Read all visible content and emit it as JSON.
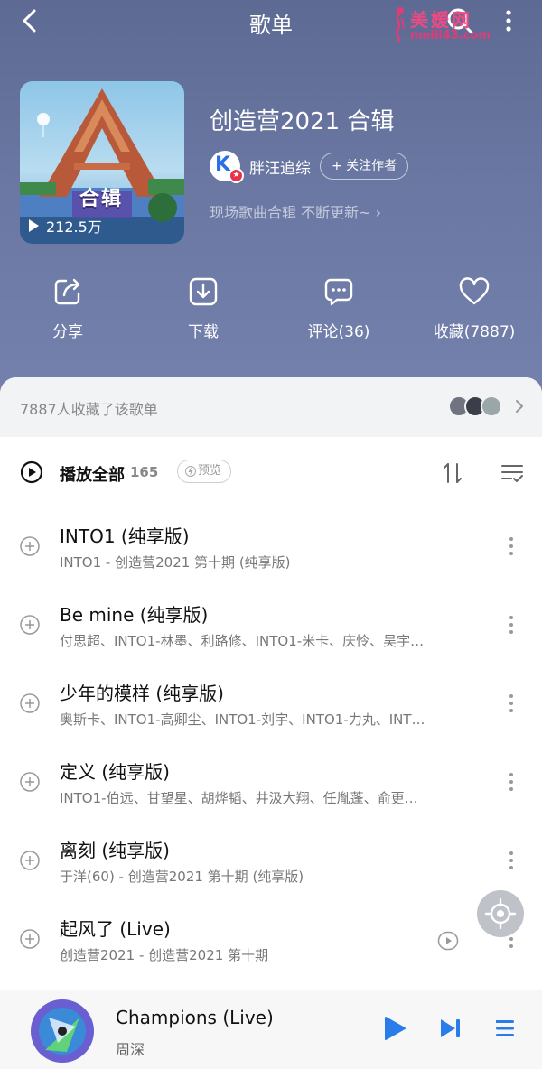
{
  "topbar": {
    "title": "歌单",
    "watermark_title": "美媛网",
    "watermark_url": "meili43.com"
  },
  "playlist": {
    "cover_label": "合辑",
    "play_count": "212.5万",
    "title": "创造营2021 合辑",
    "author": "胖汪追综",
    "author_badge": "K",
    "follow_label": "+ 关注作者",
    "description": "现场歌曲合辑 不断更新~ ›"
  },
  "actions": [
    {
      "label": "分享",
      "icon": "share-icon"
    },
    {
      "label": "下载",
      "icon": "download-icon"
    },
    {
      "label": "评论(36)",
      "icon": "comment-icon"
    },
    {
      "label": "收藏(7887)",
      "icon": "heart-icon"
    }
  ],
  "favorites": {
    "text": "7887人收藏了该歌单"
  },
  "list_header": {
    "play_all": "播放全部",
    "count": "165",
    "preview": "预览"
  },
  "songs": [
    {
      "title": "INTO1 (纯享版)",
      "subtitle": "INTO1 - 创造营2021 第十期 (纯享版)"
    },
    {
      "title": "Be mine (纯享版)",
      "subtitle": "付思超、INTO1-林墨、利路修、INTO1-米卡、庆怜、吴宇…"
    },
    {
      "title": "少年的模样 (纯享版)",
      "subtitle": "奥斯卡、INTO1-高卿尘、INTO1-刘宇、INTO1-力丸、INT…"
    },
    {
      "title": "定义 (纯享版)",
      "subtitle": "INTO1-伯远、甘望星、胡烨韬、井汲大翔、任胤蓬、俞更…"
    },
    {
      "title": "离刻 (纯享版)",
      "subtitle": "于洋(60) - 创造营2021 第十期 (纯享版)"
    },
    {
      "title": "起风了 (Live)",
      "subtitle": "创造营2021 - 创造营2021 第十期"
    }
  ],
  "player": {
    "title": "Champions (Live)",
    "artist": "周深"
  },
  "colors": {
    "header_bg": "#6a77a2",
    "accent_blue": "#2a7de8",
    "watermark_pink": "#ec4a83"
  }
}
